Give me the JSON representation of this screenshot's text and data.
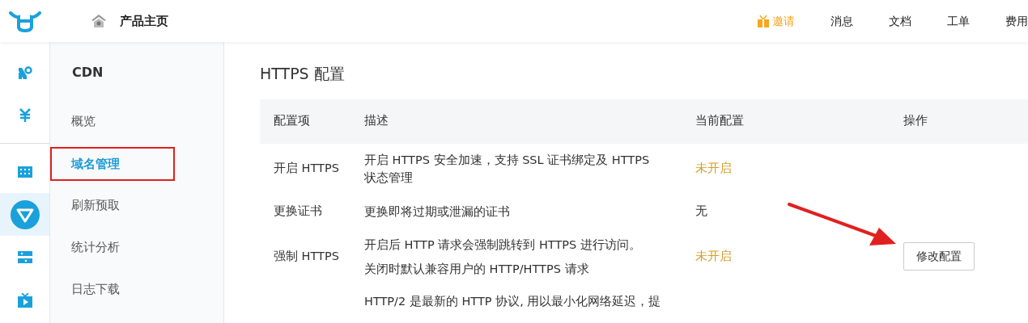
{
  "topbar": {
    "home_label": "产品主页",
    "invite": "邀请",
    "links": [
      "消息",
      "文档",
      "工单",
      "费用"
    ]
  },
  "rail_groups": [
    [
      {
        "selected": false
      },
      {
        "selected": false
      }
    ],
    [
      {
        "selected": false
      },
      {
        "selected": true
      },
      {
        "selected": false
      },
      {
        "selected": false
      }
    ]
  ],
  "sidebar": {
    "title": "CDN",
    "items": [
      {
        "label": "概览",
        "selected": false,
        "annotated": false
      },
      {
        "label": "域名管理",
        "selected": true,
        "annotated": true
      },
      {
        "label": "刷新预取",
        "selected": false,
        "annotated": false
      },
      {
        "label": "统计分析",
        "selected": false,
        "annotated": false
      },
      {
        "label": "日志下载",
        "selected": false,
        "annotated": false
      }
    ]
  },
  "page_title": "HTTPS 配置",
  "table": {
    "columns": [
      "配置项",
      "描述",
      "当前配置",
      "操作"
    ],
    "rows": [
      {
        "item": "开启 HTTPS",
        "description": [
          "开启 HTTPS 安全加速，支持 SSL 证书绑定及 HTTPS 状态管理"
        ],
        "status": "未开启",
        "highlighted": true
      },
      {
        "item": "更换证书",
        "description": [
          "更换即将过期或泄漏的证书"
        ],
        "status": "无",
        "highlighted": false
      },
      {
        "item": "强制 HTTPS",
        "description": [
          "开启后 HTTP 请求会强制跳转到 HTTPS 进行访问。",
          "关闭时默认兼容用户的 HTTP/HTTPS 请求"
        ],
        "status": "未开启",
        "highlighted": true,
        "action": "修改配置"
      },
      {
        "description": [
          "HTTP/2 是最新的 HTTP 协议, 用以最小化网络延迟，提"
        ]
      }
    ]
  },
  "annotation_arrow": true
}
